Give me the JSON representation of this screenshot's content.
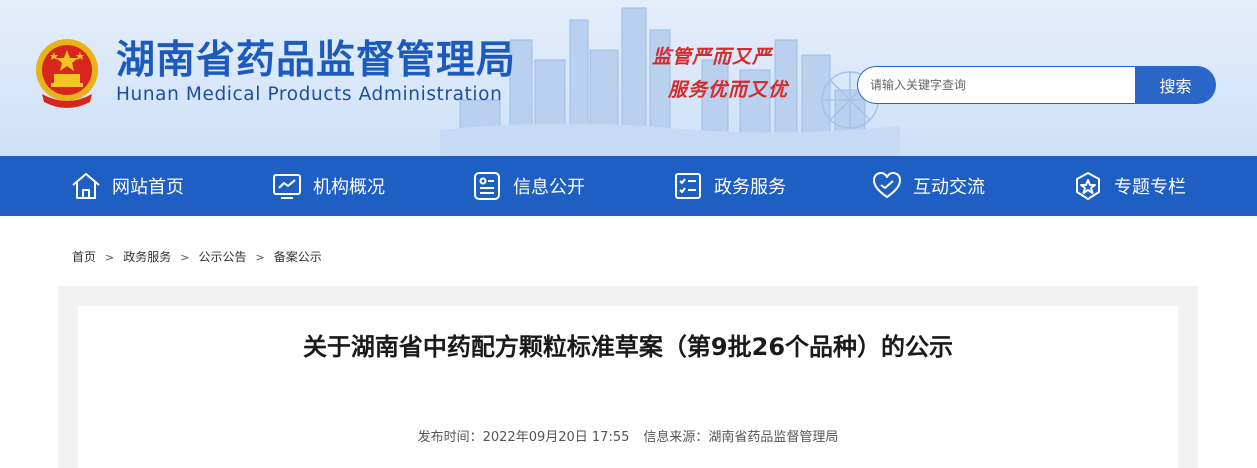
{
  "header": {
    "title": "湖南省药品监督管理局",
    "subtitle": "Hunan Medical Products Administration",
    "slogan_line1": "监管严而又严",
    "slogan_line2": "服务优而又优",
    "search": {
      "placeholder": "请输入关键字查询",
      "button_label": "搜索"
    }
  },
  "nav": {
    "items": [
      {
        "label": "网站首页",
        "icon": "home-icon"
      },
      {
        "label": "机构概况",
        "icon": "chart-monitor-icon"
      },
      {
        "label": "信息公开",
        "icon": "info-card-icon"
      },
      {
        "label": "政务服务",
        "icon": "checklist-icon"
      },
      {
        "label": "互动交流",
        "icon": "heart-hands-icon"
      },
      {
        "label": "专题专栏",
        "icon": "star-badge-icon"
      }
    ]
  },
  "breadcrumb": [
    "首页",
    "政务服务",
    "公示公告",
    "备案公示"
  ],
  "article": {
    "title": "关于湖南省中药配方颗粒标准草案（第9批26个品种）的公示",
    "publish_label": "发布时间：",
    "publish_time": "2022年09月20日 17:55",
    "source_label": "信息来源：",
    "source": "湖南省药品监督管理局"
  },
  "colors": {
    "brand_blue": "#1f5fc4",
    "title_blue": "#1c5bbd",
    "slogan_red": "#d92a2a"
  }
}
